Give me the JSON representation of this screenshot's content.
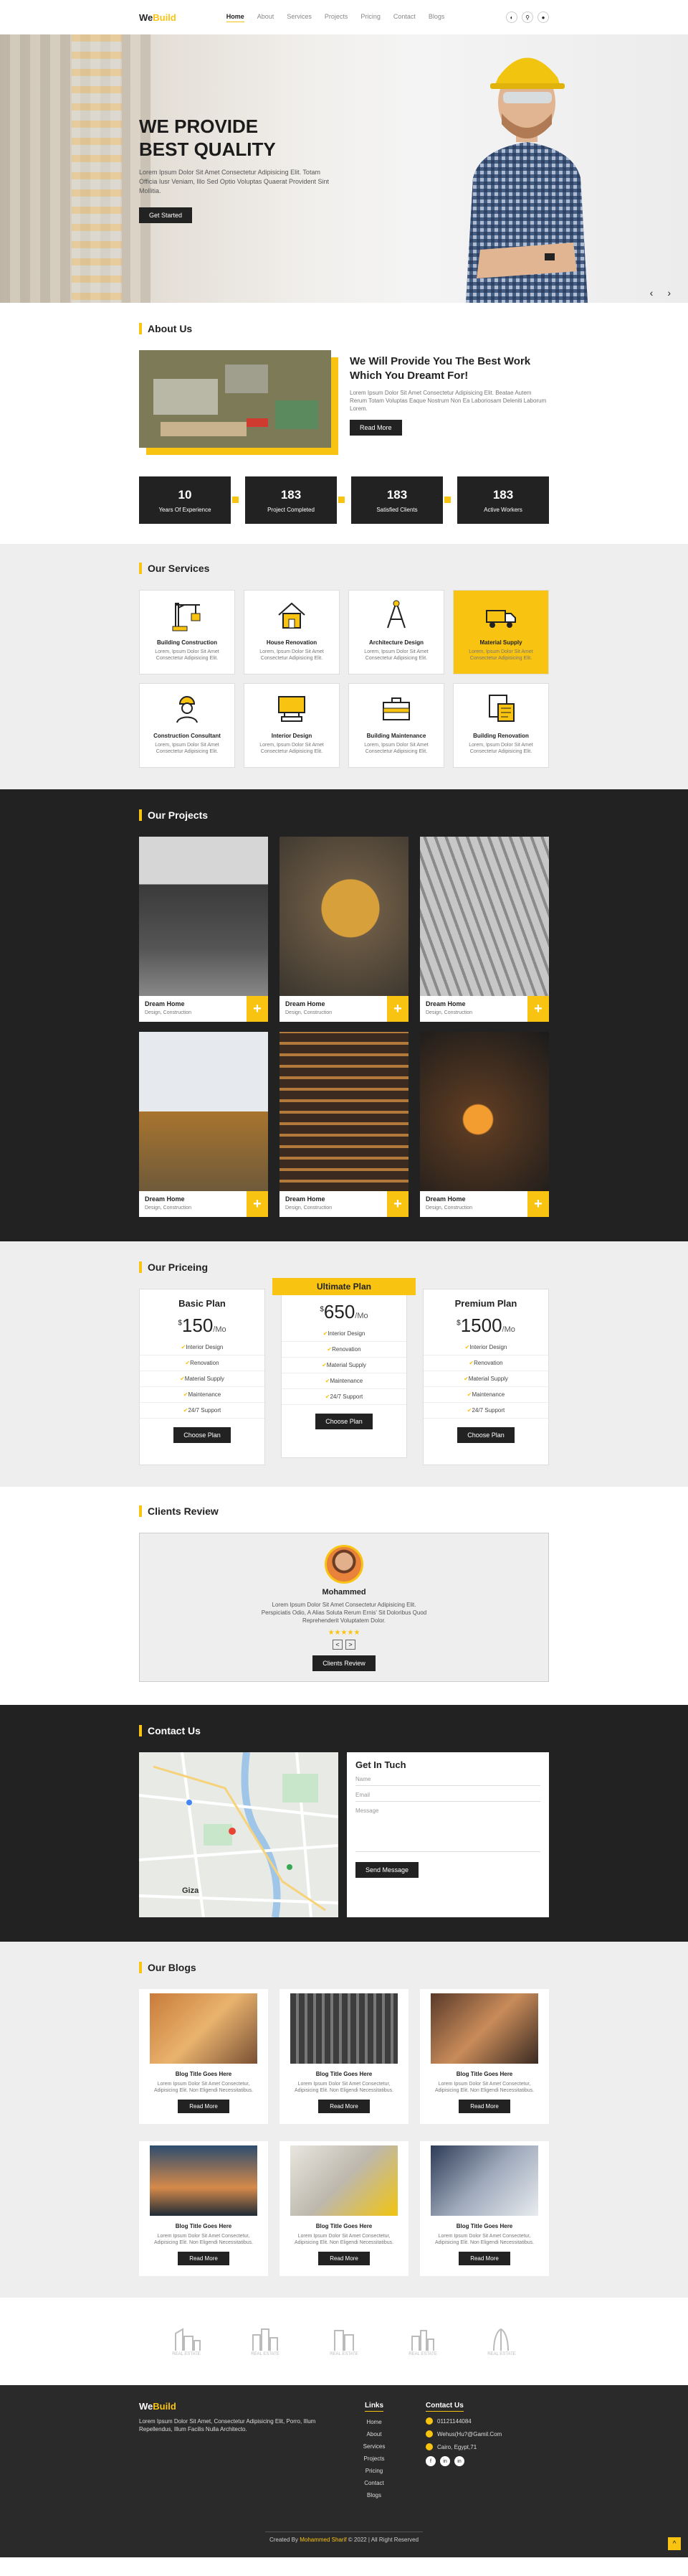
{
  "brand": {
    "prefix": "We",
    "suffix": "Build"
  },
  "nav": [
    "Home",
    "About",
    "Services",
    "Projects",
    "Pricing",
    "Contact",
    "Blogs"
  ],
  "colors": {
    "accent": "#f9c311",
    "dark": "#222222"
  },
  "hero": {
    "title_line1": "WE PROVIDE",
    "title_line2": "BEST QUALITY",
    "text": "Lorem Ipsum Dolor Sit Amet Consectetur Adipisicing Elit. Totam Officia Iusr Veniam, Illo Sed Optio Voluptas Quaerat Provident Sint Mollitia.",
    "button": "Get Started"
  },
  "about": {
    "title": "About Us",
    "heading": "We Will Provide You The Best Work Which You Dreamt For!",
    "text": "Lorem Ipsum Dolor Sit Amet Consectetur Adipisicing Elit. Beatae Autem Rerum Totam Voluptas Eaque Nostrum Non Ea Laboriosam Deleniti Laborum Lorem.",
    "button": "Read More",
    "stats": [
      {
        "value": "10",
        "label": "Years Of Experience"
      },
      {
        "value": "183",
        "label": "Project Completed"
      },
      {
        "value": "183",
        "label": "Satisfied Clients"
      },
      {
        "value": "183",
        "label": "Active Workers"
      }
    ]
  },
  "services": {
    "title": "Our Services",
    "desc": "Lorem, Ipsum Dolor Sit Amet Consectetur Adipisicing Elit.",
    "items": [
      {
        "name": "Building Construction",
        "icon": "crane-icon"
      },
      {
        "name": "House Renovation",
        "icon": "house-icon"
      },
      {
        "name": "Architecture Design",
        "icon": "compass-icon"
      },
      {
        "name": "Material Supply",
        "icon": "truck-icon"
      },
      {
        "name": "Construction Consultant",
        "icon": "worker-icon"
      },
      {
        "name": "Interior Design",
        "icon": "sofa-icon"
      },
      {
        "name": "Building Maintenance",
        "icon": "toolbox-icon"
      },
      {
        "name": "Building Renovation",
        "icon": "blueprint-icon"
      }
    ]
  },
  "projects": {
    "title": "Our Projects",
    "items": [
      {
        "name": "Dream Home",
        "sub": "Design, Construction"
      },
      {
        "name": "Dream Home",
        "sub": "Design, Construction"
      },
      {
        "name": "Dream Home",
        "sub": "Design, Construction"
      },
      {
        "name": "Dream Home",
        "sub": "Design, Construction"
      },
      {
        "name": "Dream Home",
        "sub": "Design, Construction"
      },
      {
        "name": "Dream Home",
        "sub": "Design, Construction"
      }
    ]
  },
  "pricing": {
    "title": "Our Priceing",
    "plans": [
      {
        "name": "Basic Plan",
        "currency": "$",
        "price": "150",
        "period": "/Mo",
        "features": [
          "Interior Design",
          "Renovation",
          "Material Supply",
          "Maintenance",
          "24/7 Support"
        ],
        "button": "Choose Plan"
      },
      {
        "name": "Ultimate Plan",
        "currency": "$",
        "price": "650",
        "period": "/Mo",
        "features": [
          "Interior Design",
          "Renovation",
          "Material Supply",
          "Maintenance",
          "24/7 Support"
        ],
        "button": "Choose Plan"
      },
      {
        "name": "Premium Plan",
        "currency": "$",
        "price": "1500",
        "period": "/Mo",
        "features": [
          "Interior Design",
          "Renovation",
          "Material Supply",
          "Maintenance",
          "24/7 Support"
        ],
        "button": "Choose Plan"
      }
    ]
  },
  "reviews": {
    "title": "Clients Review",
    "name": "Mohammed",
    "text": "Lorem Ipsum Dolor Sit Amet Consectetur Adipisicing Elit. Perspiciatis Odio, A Alias Soluta Rerum Ernis' Sit Doloribus Quod Reprehenderit Voluptatem Dolor.",
    "stars": "★★★★★",
    "prev": "<",
    "next": ">",
    "button": "Clients Review"
  },
  "contact": {
    "title": "Contact Us",
    "form_title": "Get In Tuch",
    "name_ph": "Name",
    "email_ph": "Email",
    "message_ph": "Message",
    "button": "Send Message",
    "map_label": "Giza"
  },
  "blogs": {
    "title": "Our Blogs",
    "item_title": "Blog Title Goes Here",
    "item_text": "Lorem Ipsum Dolor Sit Amet Consectetur, Adipisicing Elit. Non Eligendi Necessitatibus.",
    "button": "Read More"
  },
  "partners": {
    "label": "REAL ESTATE",
    "count": 5
  },
  "footer": {
    "about": "Lorem Ipsum Dolor Sit Amet, Consectetur Adipisicing Elit, Porro, Illum Repellendus, Illum Facilis Nulla Architecto.",
    "links_title": "Links",
    "links": [
      "Home",
      "About",
      "Services",
      "Projects",
      "Pricing",
      "Contact",
      "Blogs"
    ],
    "contact_title": "Contact Us",
    "phone": "01121144084",
    "email": "Wehus(Hu?@Gamil.Com",
    "address": "Cairo, Egypt,71",
    "socials": [
      "f",
      "in",
      "in"
    ],
    "copyright_prefix": "Created By",
    "copyright_name": "Mohammed Sharif",
    "copyright_suffix": "© 2022 | All Right Reserved",
    "to_top": "^"
  }
}
